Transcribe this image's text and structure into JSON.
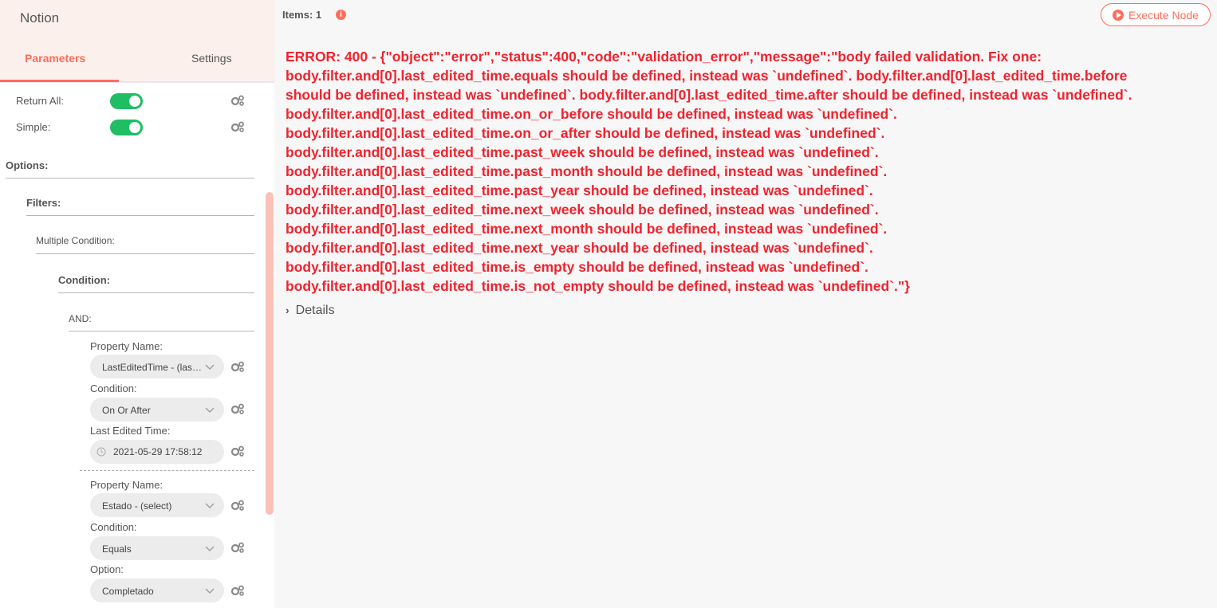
{
  "panel": {
    "title": "Notion",
    "tabs": {
      "parameters": "Parameters",
      "settings": "Settings"
    }
  },
  "params": {
    "return_all_label": "Return All:",
    "return_all_value": true,
    "simple_label": "Simple:",
    "simple_value": true,
    "options_label": "Options:",
    "filters_label": "Filters:",
    "multiple_condition_label": "Multiple Condition:",
    "condition_label": "Condition:",
    "and_label": "AND:",
    "conditions": [
      {
        "property_name_label": "Property Name:",
        "property_name_value": "LastEditedTime - (last_edited_time)",
        "condition_label": "Condition:",
        "condition_value": "On Or After",
        "third_label": "Last Edited Time:",
        "third_value": "2021-05-29 17:58:12"
      },
      {
        "property_name_label": "Property Name:",
        "property_name_value": "Estado - (select)",
        "condition_label": "Condition:",
        "condition_value": "Equals",
        "third_label": "Option:",
        "third_value": "Completado"
      }
    ]
  },
  "output": {
    "items_label": "Items: 1",
    "info_icon": "i",
    "execute_label": "Execute Node",
    "error_lines": [
      "ERROR: 400 - {\"object\":\"error\",\"status\":400,\"code\":\"validation_error\",\"message\":\"body failed validation. Fix one:",
      "body.filter.and[0].last_edited_time.equals should be defined, instead was `undefined`. body.filter.and[0].last_edited_time.before",
      "should be defined, instead was `undefined`. body.filter.and[0].last_edited_time.after should be defined, instead was `undefined`.",
      "body.filter.and[0].last_edited_time.on_or_before should be defined, instead was `undefined`.",
      "body.filter.and[0].last_edited_time.on_or_after should be defined, instead was `undefined`.",
      "body.filter.and[0].last_edited_time.past_week should be defined, instead was `undefined`.",
      "body.filter.and[0].last_edited_time.past_month should be defined, instead was `undefined`.",
      "body.filter.and[0].last_edited_time.past_year should be defined, instead was `undefined`.",
      "body.filter.and[0].last_edited_time.next_week should be defined, instead was `undefined`.",
      "body.filter.and[0].last_edited_time.next_month should be defined, instead was `undefined`.",
      "body.filter.and[0].last_edited_time.next_year should be defined, instead was `undefined`.",
      "body.filter.and[0].last_edited_time.is_empty should be defined, instead was `undefined`.",
      "body.filter.and[0].last_edited_time.is_not_empty should be defined, instead was `undefined`.\"}"
    ],
    "details_label": "Details"
  },
  "colors": {
    "accent": "#ff6d5a",
    "error": "#f0232e",
    "toggle_on": "#1fbe63",
    "header_bg": "#fcf0ec"
  },
  "icons": [
    "gear-icon",
    "chevron-down-icon",
    "clock-icon",
    "info-icon",
    "play-icon",
    "caret-right-icon"
  ]
}
